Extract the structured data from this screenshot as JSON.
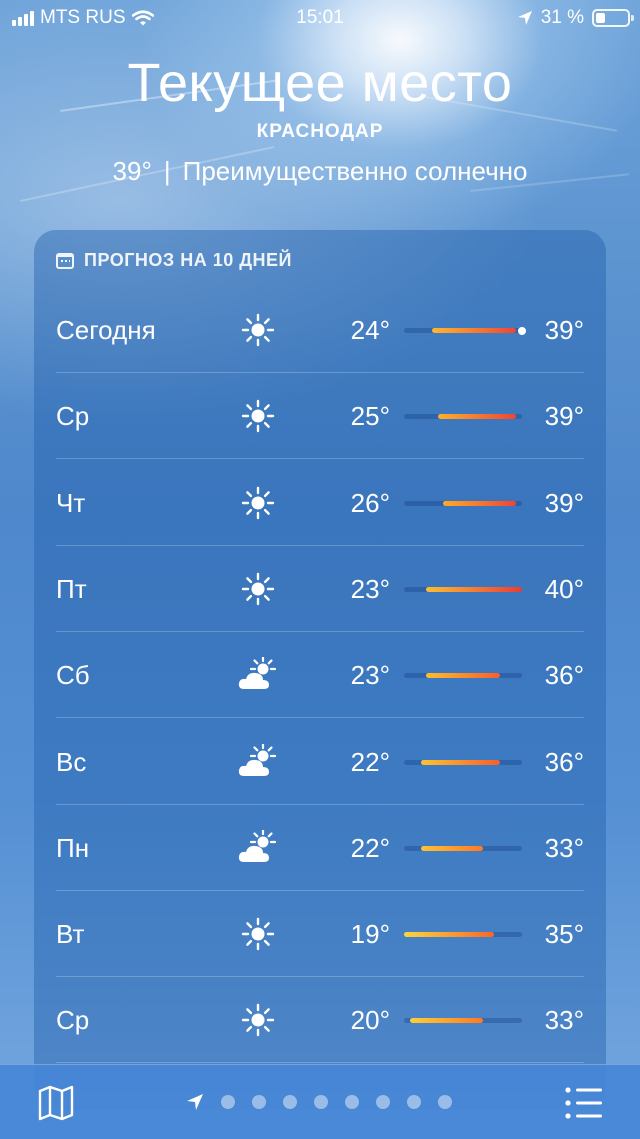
{
  "status_bar": {
    "carrier": "MTS RUS",
    "time": "15:01",
    "battery": "31 %",
    "battery_level": 0.31
  },
  "location": {
    "title": "Текущее место",
    "city": "КРАСНОДАР",
    "temperature": "39°",
    "separator": "|",
    "condition": "Преимущественно солнечно"
  },
  "forecast": {
    "header": "ПРОГНОЗ НА 10 ДНЕЙ",
    "range_min": 19,
    "range_max": 40,
    "current_temp": 39,
    "days": [
      {
        "day": "Сегодня",
        "icon": "sun-icon",
        "low": "24°",
        "high": "39°",
        "low_val": 24,
        "high_val": 39,
        "current": true
      },
      {
        "day": "Ср",
        "icon": "sun-icon",
        "low": "25°",
        "high": "39°",
        "low_val": 25,
        "high_val": 39
      },
      {
        "day": "Чт",
        "icon": "sun-icon",
        "low": "26°",
        "high": "39°",
        "low_val": 26,
        "high_val": 39
      },
      {
        "day": "Пт",
        "icon": "sun-icon",
        "low": "23°",
        "high": "40°",
        "low_val": 23,
        "high_val": 40
      },
      {
        "day": "Сб",
        "icon": "partly-cloudy-icon",
        "low": "23°",
        "high": "36°",
        "low_val": 23,
        "high_val": 36
      },
      {
        "day": "Вс",
        "icon": "partly-cloudy-icon",
        "low": "22°",
        "high": "36°",
        "low_val": 22,
        "high_val": 36
      },
      {
        "day": "Пн",
        "icon": "partly-cloudy-icon",
        "low": "22°",
        "high": "33°",
        "low_val": 22,
        "high_val": 33
      },
      {
        "day": "Вт",
        "icon": "sun-icon",
        "low": "19°",
        "high": "35°",
        "low_val": 19,
        "high_val": 35
      },
      {
        "day": "Ср",
        "icon": "sun-icon",
        "low": "20°",
        "high": "33°",
        "low_val": 20,
        "high_val": 33
      }
    ]
  },
  "bottom_bar": {
    "map_icon": "map-icon",
    "list_icon": "list-icon",
    "location_icon": "location-arrow-icon",
    "page_count": 8
  }
}
